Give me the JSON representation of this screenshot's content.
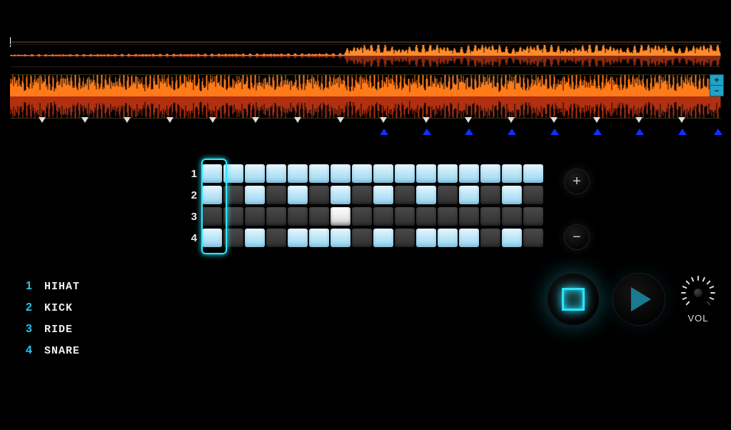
{
  "waveform": {
    "zoom_plus": "+",
    "zoom_minus": "−",
    "beat_markers_down_pct": [
      4,
      10,
      16,
      22,
      28,
      34,
      40,
      46,
      52,
      58,
      64,
      70,
      76,
      82,
      88,
      94
    ],
    "beat_markers_up_pct": [
      52,
      58,
      64,
      70,
      76,
      82,
      88,
      94,
      99
    ]
  },
  "sequencer": {
    "steps": 16,
    "playhead_step": 0,
    "rows": [
      {
        "num": "1",
        "pattern": [
          1,
          1,
          1,
          1,
          1,
          1,
          1,
          1,
          1,
          1,
          1,
          1,
          1,
          1,
          1,
          1
        ]
      },
      {
        "num": "2",
        "pattern": [
          1,
          0,
          1,
          0,
          1,
          0,
          1,
          0,
          1,
          0,
          1,
          0,
          1,
          0,
          1,
          0
        ]
      },
      {
        "num": "3",
        "pattern": [
          0,
          0,
          0,
          0,
          0,
          0,
          2,
          0,
          0,
          0,
          0,
          0,
          0,
          0,
          0,
          0
        ]
      },
      {
        "num": "4",
        "pattern": [
          1,
          0,
          1,
          0,
          1,
          1,
          1,
          0,
          1,
          0,
          1,
          1,
          1,
          0,
          1,
          0
        ]
      }
    ],
    "add_label": "+",
    "remove_label": "−"
  },
  "legend": [
    {
      "num": "1",
      "name": "HIHAT"
    },
    {
      "num": "2",
      "name": "KICK"
    },
    {
      "num": "3",
      "name": "RIDE"
    },
    {
      "num": "4",
      "name": "SNARE"
    }
  ],
  "transport": {
    "stop_label": "Stop",
    "play_label": "Play",
    "volume_label": "VOL",
    "volume_value": 0.95
  },
  "colors": {
    "accent": "#29e5ff",
    "wave_hot": "#ff7a18",
    "wave_cold": "#a03010",
    "marker_blue": "#1030ff"
  }
}
